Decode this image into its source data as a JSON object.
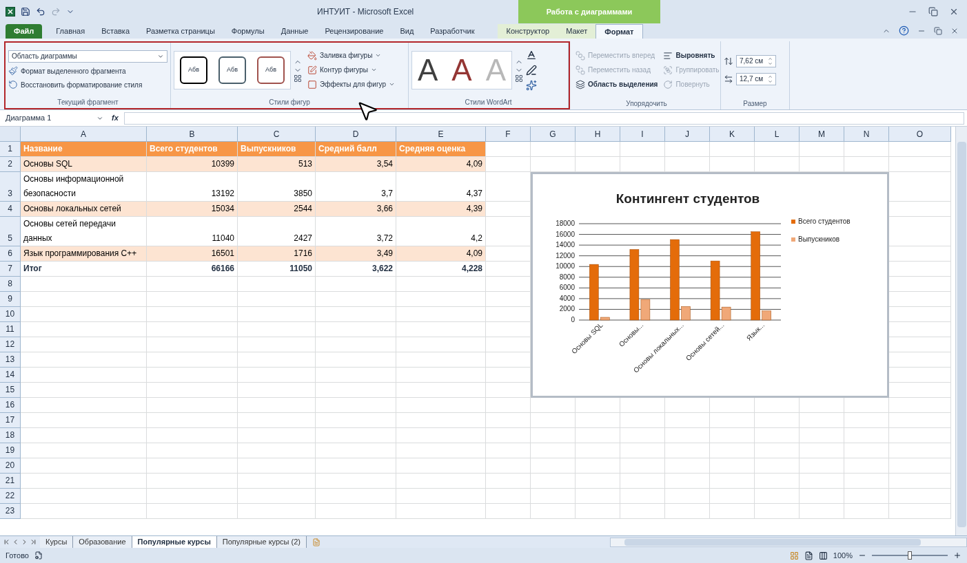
{
  "title_bar": {
    "title": "ИНТУИТ - Microsoft Excel",
    "context_header": "Работа с диаграммами"
  },
  "ribbon_tabs": [
    {
      "label": "Файл",
      "kind": "file",
      "selected": false
    },
    {
      "label": "Главная",
      "kind": "normal",
      "selected": false
    },
    {
      "label": "Вставка",
      "kind": "normal",
      "selected": false
    },
    {
      "label": "Разметка страницы",
      "kind": "normal",
      "selected": false
    },
    {
      "label": "Формулы",
      "kind": "normal",
      "selected": false
    },
    {
      "label": "Данные",
      "kind": "normal",
      "selected": false
    },
    {
      "label": "Рецензирование",
      "kind": "normal",
      "selected": false
    },
    {
      "label": "Вид",
      "kind": "normal",
      "selected": false
    },
    {
      "label": "Разработчик",
      "kind": "normal",
      "selected": false
    },
    {
      "label": "Конструктор",
      "kind": "context",
      "selected": false
    },
    {
      "label": "Макет",
      "kind": "context",
      "selected": false
    },
    {
      "label": "Формат",
      "kind": "context",
      "selected": true
    }
  ],
  "ribbon": {
    "current_selection": {
      "label": "Текущий фрагмент",
      "dropdown": "Область диаграммы",
      "buttons": [
        "Формат выделенного фрагмента",
        "Восстановить форматирование стиля"
      ]
    },
    "shape_styles": {
      "label": "Стили фигур",
      "samples": [
        {
          "text": "Абв",
          "color": "#000000"
        },
        {
          "text": "Абв",
          "color": "#4a5f6b"
        },
        {
          "text": "Абв",
          "color": "#a0524d"
        }
      ],
      "commands": [
        "Заливка фигуры",
        "Контур фигуры",
        "Эффекты для фигур"
      ]
    },
    "wordart": {
      "label": "Стили WordArt",
      "samples": [
        {
          "text": "A",
          "color": "#404040"
        },
        {
          "text": "A",
          "color": "#943634"
        },
        {
          "text": "A",
          "color": "#b8b8b8"
        }
      ]
    },
    "arrange": {
      "label": "Упорядочить",
      "commands": [
        {
          "label": "Переместить вперед",
          "disabled": true
        },
        {
          "label": "Переместить назад",
          "disabled": true
        },
        {
          "label": "Область выделения",
          "disabled": false
        },
        {
          "label": "Выровнять",
          "disabled": false
        },
        {
          "label": "Группировать",
          "disabled": true
        },
        {
          "label": "Повернуть",
          "disabled": true
        }
      ]
    },
    "size": {
      "label": "Размер",
      "height": "7,62 см",
      "width": "12,7 см"
    }
  },
  "formula_bar": {
    "name_box": "Диаграмма 1",
    "fx": "fx"
  },
  "sheet": {
    "columns": [
      "A",
      "B",
      "C",
      "D",
      "E",
      "F",
      "G",
      "H",
      "I",
      "J",
      "K",
      "L",
      "M",
      "N",
      "O"
    ],
    "rows": [
      {
        "number": "1",
        "kind": "header",
        "cells": [
          "Название",
          "Всего студентов",
          "Выпускников",
          "Средний балл",
          "Средняя оценка"
        ]
      },
      {
        "number": "2",
        "kind": "band",
        "cells": [
          "Основы SQL",
          "10399",
          "513",
          "3,54",
          "4,09"
        ]
      },
      {
        "number": "3",
        "kind": "plain",
        "cells": [
          "Основы информационной безопасности",
          "13192",
          "3850",
          "3,7",
          "4,37"
        ]
      },
      {
        "number": "4",
        "kind": "band",
        "cells": [
          "Основы локальных сетей",
          "15034",
          "2544",
          "3,66",
          "4,39"
        ]
      },
      {
        "number": "5",
        "kind": "plain",
        "cells": [
          "Основы сетей передачи данных",
          "11040",
          "2427",
          "3,72",
          "4,2"
        ]
      },
      {
        "number": "6",
        "kind": "band",
        "cells": [
          "Язык программирования С++",
          "16501",
          "1716",
          "3,49",
          "4,09"
        ]
      },
      {
        "number": "7",
        "kind": "total",
        "cells": [
          "Итог",
          "66166",
          "11050",
          "3,622",
          "4,228"
        ]
      },
      {
        "number": "8",
        "kind": "empty"
      },
      {
        "number": "9",
        "kind": "empty"
      },
      {
        "number": "10",
        "kind": "empty"
      },
      {
        "number": "11",
        "kind": "empty"
      },
      {
        "number": "12",
        "kind": "empty"
      },
      {
        "number": "13",
        "kind": "empty"
      },
      {
        "number": "14",
        "kind": "empty"
      },
      {
        "number": "15",
        "kind": "empty"
      },
      {
        "number": "16",
        "kind": "empty"
      },
      {
        "number": "17",
        "kind": "empty"
      },
      {
        "number": "18",
        "kind": "empty"
      },
      {
        "number": "19",
        "kind": "empty"
      },
      {
        "number": "20",
        "kind": "empty"
      },
      {
        "number": "21",
        "kind": "empty"
      },
      {
        "number": "22",
        "kind": "empty"
      },
      {
        "number": "23",
        "kind": "empty"
      }
    ]
  },
  "chart": {
    "chart_data": {
      "type": "bar",
      "title": "Контингент студентов",
      "categories": [
        "Основы SQL",
        "Основы...",
        "Основы локальных...",
        "Основы сетей...",
        "Язык..."
      ],
      "series": [
        {
          "name": "Всего студентов",
          "color": "#e46c0a",
          "values": [
            10399,
            13192,
            15034,
            11040,
            16501
          ]
        },
        {
          "name": "Выпускников",
          "color": "#f0a878",
          "values": [
            513,
            3850,
            2544,
            2427,
            1716
          ]
        }
      ],
      "grid": true,
      "legend": true,
      "ylim": [
        0,
        18000
      ],
      "yticks": [
        0,
        2000,
        4000,
        6000,
        8000,
        10000,
        12000,
        14000,
        16000,
        18000
      ]
    }
  },
  "sheet_tabs": [
    {
      "label": "Курсы",
      "selected": false
    },
    {
      "label": "Образование",
      "selected": false
    },
    {
      "label": "Популярные курсы",
      "selected": true
    },
    {
      "label": "Популярные курсы (2)",
      "selected": false
    }
  ],
  "status_bar": {
    "status": "Готово",
    "zoom": "100%",
    "zoom_slider": {
      "level": 0.5
    }
  }
}
